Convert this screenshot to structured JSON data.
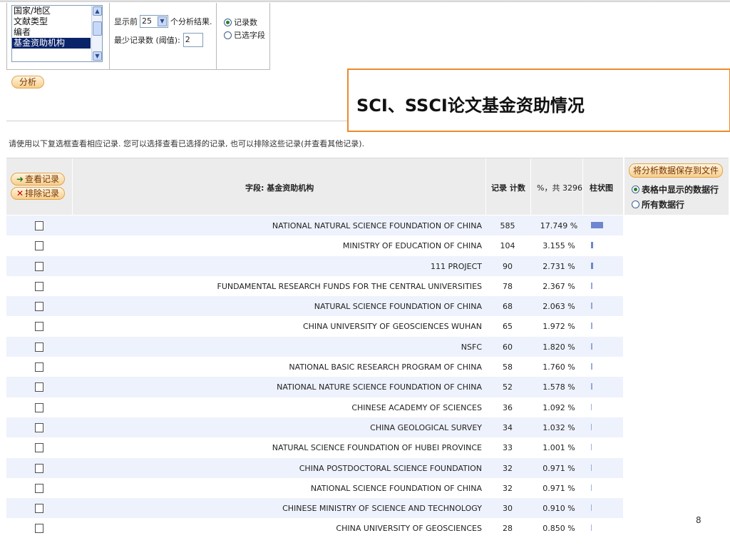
{
  "options": {
    "field_list": [
      "国家/地区",
      "文献类型",
      "编者",
      "基金资助机构"
    ],
    "selected_field": "基金资助机构",
    "show_prefix": "显示前",
    "show_value": "25",
    "show_suffix": "个分析结果.",
    "threshold_label": "最少记录数 (阈值):",
    "threshold_value": "2",
    "radio_records": "记录数",
    "radio_selected_field": "已选字段",
    "analyze_button": "分析"
  },
  "callout_text": "SCI、SSCI论文基金资助情况",
  "instructions": "请使用以下复选框查看相应记录. 您可以选择查看已选择的记录, 也可以排除这些记录(并查看其他记录).",
  "table": {
    "view_button": "查看记录",
    "exclude_button": "排除记录",
    "col_field": "字段: 基金资助机构",
    "col_count": "记录 计数",
    "col_pct": "%，共 3296",
    "col_chart": "柱状图",
    "bar_color": "#6d86cf",
    "rows": [
      {
        "name": "NATIONAL NATURAL SCIENCE FOUNDATION OF CHINA",
        "count": "585",
        "pct": "17.749 %"
      },
      {
        "name": "MINISTRY OF EDUCATION OF CHINA",
        "count": "104",
        "pct": "3.155 %"
      },
      {
        "name": "111 PROJECT",
        "count": "90",
        "pct": "2.731 %"
      },
      {
        "name": "FUNDAMENTAL RESEARCH FUNDS FOR THE CENTRAL UNIVERSITIES",
        "count": "78",
        "pct": "2.367 %"
      },
      {
        "name": "NATURAL SCIENCE FOUNDATION OF CHINA",
        "count": "68",
        "pct": "2.063 %"
      },
      {
        "name": "CHINA UNIVERSITY OF GEOSCIENCES WUHAN",
        "count": "65",
        "pct": "1.972 %"
      },
      {
        "name": "NSFC",
        "count": "60",
        "pct": "1.820 %"
      },
      {
        "name": "NATIONAL BASIC RESEARCH PROGRAM OF CHINA",
        "count": "58",
        "pct": "1.760 %"
      },
      {
        "name": "NATIONAL NATURE SCIENCE FOUNDATION OF CHINA",
        "count": "52",
        "pct": "1.578 %"
      },
      {
        "name": "CHINESE ACADEMY OF SCIENCES",
        "count": "36",
        "pct": "1.092 %"
      },
      {
        "name": "CHINA GEOLOGICAL SURVEY",
        "count": "34",
        "pct": "1.032 %"
      },
      {
        "name": "NATURAL SCIENCE FOUNDATION OF HUBEI PROVINCE",
        "count": "33",
        "pct": "1.001 %"
      },
      {
        "name": "CHINA POSTDOCTORAL SCIENCE FOUNDATION",
        "count": "32",
        "pct": "0.971 %"
      },
      {
        "name": "NATIONAL SCIENCE FOUNDATION OF CHINA",
        "count": "32",
        "pct": "0.971 %"
      },
      {
        "name": "CHINESE MINISTRY OF SCIENCE AND TECHNOLOGY",
        "count": "30",
        "pct": "0.910 %"
      },
      {
        "name": "CHINA UNIVERSITY OF GEOSCIENCES",
        "count": "28",
        "pct": "0.850 %"
      }
    ]
  },
  "side": {
    "save_button": "将分析数据保存到文件",
    "radio_table_rows": "表格中显示的数据行",
    "radio_all_rows": "所有数据行"
  },
  "page_number": "8"
}
